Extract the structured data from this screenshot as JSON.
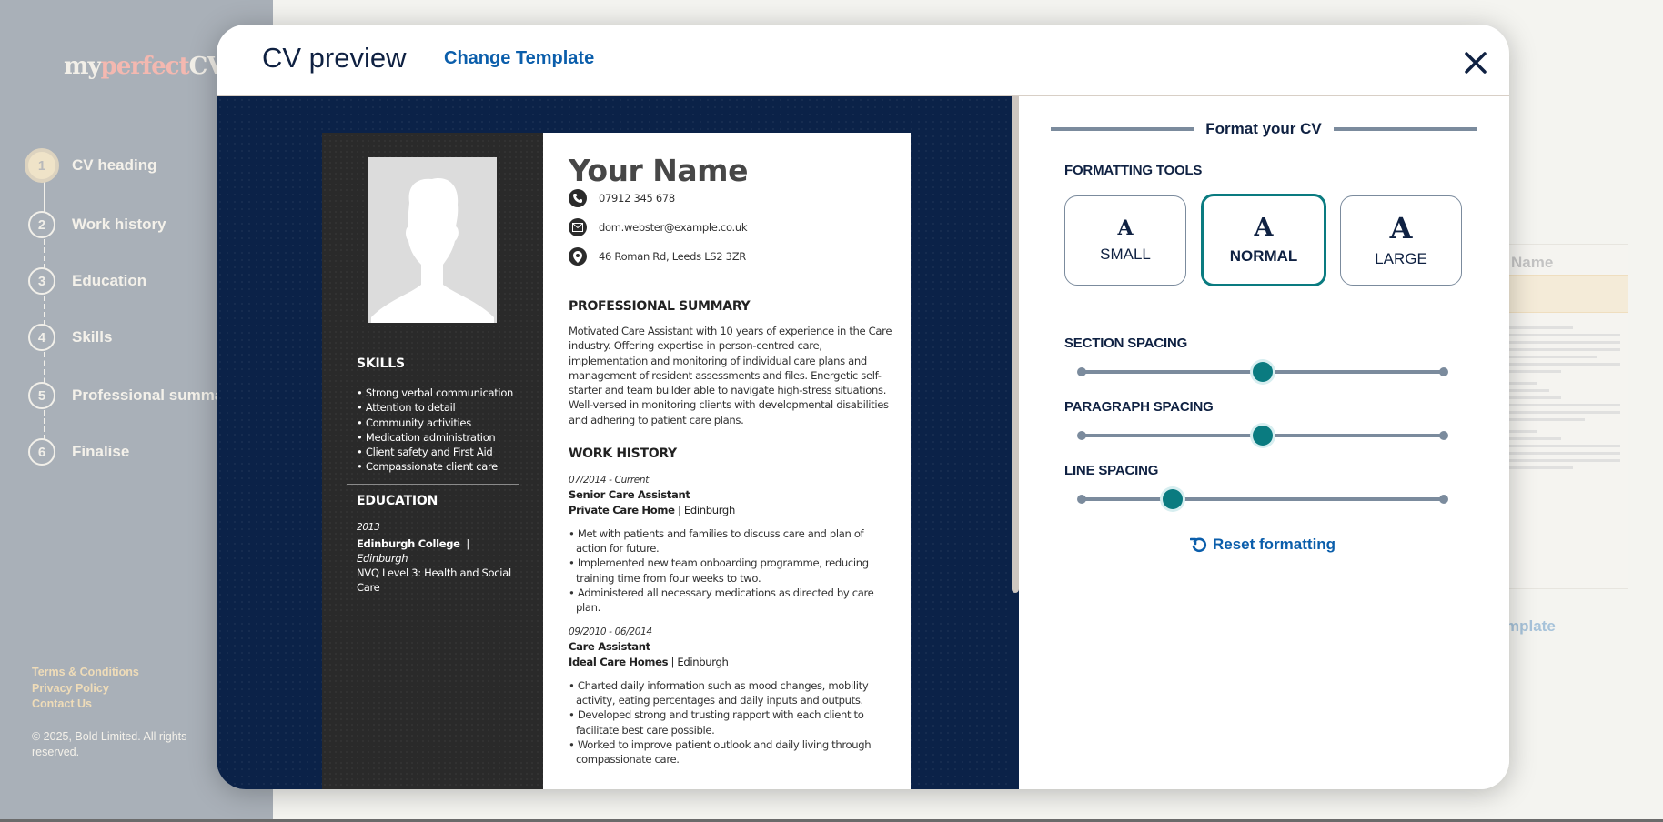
{
  "background": {
    "logo": {
      "part1": "my",
      "part2": "perfect",
      "part3": "CV"
    },
    "steps": [
      {
        "number": "1",
        "label": "CV heading",
        "active": true
      },
      {
        "number": "2",
        "label": "Work history"
      },
      {
        "number": "3",
        "label": "Education"
      },
      {
        "number": "4",
        "label": "Skills"
      },
      {
        "number": "5",
        "label": "Professional summary"
      },
      {
        "number": "6",
        "label": "Finalise"
      }
    ],
    "footer_links": [
      "Terms & Conditions",
      "Privacy Policy",
      "Contact Us"
    ],
    "copyright": "© 2025, Bold Limited. All rights reserved.",
    "ghost_name": "Name",
    "ghost_template_link": "mplate"
  },
  "modal": {
    "title": "CV preview",
    "change_template": "Change Template",
    "close_icon": "close-icon"
  },
  "cv": {
    "name": "Your Name",
    "phone": "07912 345 678",
    "email": "dom.webster@example.co.uk",
    "address": "46 Roman Rd, Leeds LS2 3ZR",
    "skills_title": "SKILLS",
    "skills": [
      "Strong verbal communication",
      "Attention to detail",
      "Community activities",
      "Medication administration",
      "Client safety and First Aid",
      "Compassionate client care"
    ],
    "education_title": "EDUCATION",
    "education": {
      "year": "2013",
      "school": "Edinburgh College",
      "separator": "|",
      "city": "Edinburgh",
      "qualification": "NVQ Level 3: Health and Social Care"
    },
    "summary_title": "PROFESSIONAL SUMMARY",
    "summary": "Motivated Care Assistant with 10 years of experience in the Care industry. Offering expertise in person-centred care, implementation and monitoring of individual care plans and management of resident assessments and files. Energetic self-starter and team builder able to navigate high-stress situations. Well-versed in monitoring clients with developmental disabilities and adhering to patient care plans.",
    "work_title": "WORK HISTORY",
    "jobs": [
      {
        "dates": "07/2014 - Current",
        "role": "Senior Care Assistant",
        "company": "Private Care Home",
        "location": "| Edinburgh",
        "bullets": [
          "Met with patients and families to discuss care and plan of action for future.",
          "Implemented new team onboarding programme, reducing training time from four weeks to two.",
          "Administered all necessary medications as directed by care plan."
        ]
      },
      {
        "dates": "09/2010 - 06/2014",
        "role": "Care Assistant",
        "company": "Ideal Care Homes",
        "location": "| Edinburgh",
        "bullets": [
          "Charted daily information such as mood changes, mobility activity, eating percentages and daily inputs and outputs.",
          "Developed strong and trusting rapport with each client to facilitate best care possible.",
          "Worked to improve patient outlook and daily living through compassionate care."
        ]
      }
    ]
  },
  "format": {
    "title": "Format your CV",
    "tools_label": "FORMATTING TOOLS",
    "sizes": [
      {
        "glyph": "A",
        "label": "SMALL"
      },
      {
        "glyph": "A",
        "label": "NORMAL",
        "selected": true
      },
      {
        "glyph": "A",
        "label": "LARGE"
      }
    ],
    "section_spacing": {
      "label": "SECTION SPACING",
      "value_percent": 50
    },
    "paragraph_spacing": {
      "label": "PARAGRAPH SPACING",
      "value_percent": 50
    },
    "line_spacing": {
      "label": "LINE SPACING",
      "value_percent": 25
    },
    "reset_label": "Reset formatting"
  },
  "colors": {
    "accent_teal": "#0a7b80",
    "link_blue": "#0b5eab",
    "navy": "#0f2142",
    "preview_bg": "#0b2248",
    "cv_sidebar": "#2a2a2a"
  }
}
